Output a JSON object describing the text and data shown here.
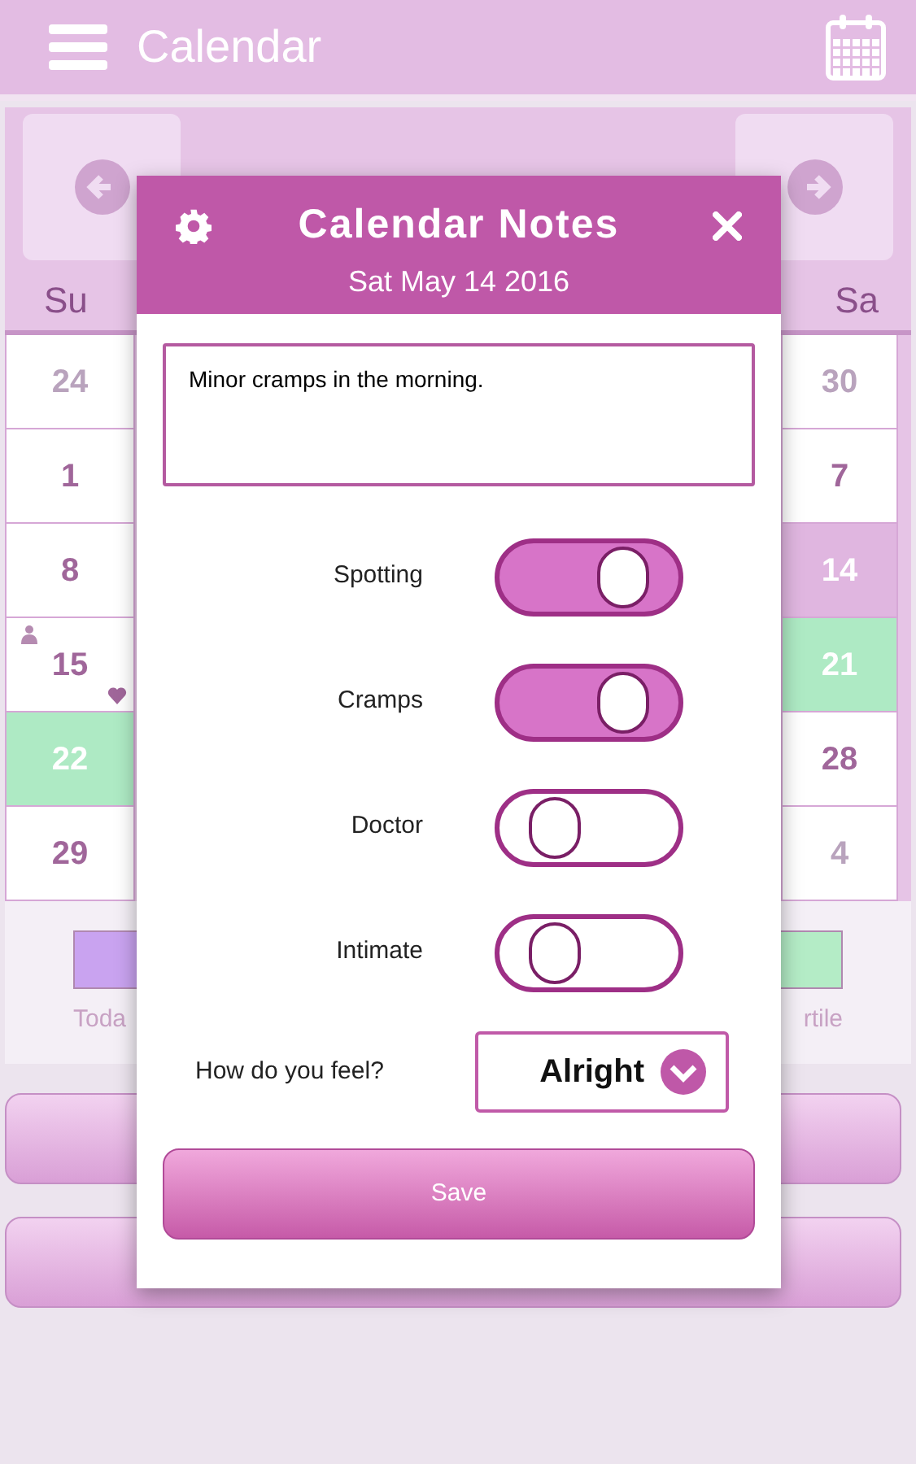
{
  "header": {
    "title": "Calendar"
  },
  "weekdays": {
    "left": "Su",
    "right": "Sa"
  },
  "left_days": [
    {
      "day": "24",
      "kind": "other"
    },
    {
      "day": "1",
      "kind": "normal"
    },
    {
      "day": "8",
      "kind": "normal"
    },
    {
      "day": "15",
      "kind": "marked"
    },
    {
      "day": "22",
      "kind": "fertile"
    },
    {
      "day": "29",
      "kind": "normal"
    }
  ],
  "right_days": [
    {
      "day": "30",
      "kind": "other"
    },
    {
      "day": "7",
      "kind": "normal"
    },
    {
      "day": "14",
      "kind": "selected"
    },
    {
      "day": "21",
      "kind": "fertile"
    },
    {
      "day": "28",
      "kind": "normal"
    },
    {
      "day": "4",
      "kind": "other"
    }
  ],
  "legend": [
    {
      "label": "Toda",
      "color": "#c9a3f0"
    },
    {
      "label": "rtile",
      "color": "#b4ecc6"
    }
  ],
  "dialog": {
    "title": "Calendar Notes",
    "date": "Sat May 14 2016",
    "note": "Minor cramps in the morning.",
    "toggles": [
      {
        "label": "Spotting",
        "on": true
      },
      {
        "label": "Cramps",
        "on": true
      },
      {
        "label": "Doctor",
        "on": false
      },
      {
        "label": "Intimate",
        "on": false
      }
    ],
    "feeling_label": "How do you feel?",
    "feeling": "Alright",
    "save": "Save"
  }
}
